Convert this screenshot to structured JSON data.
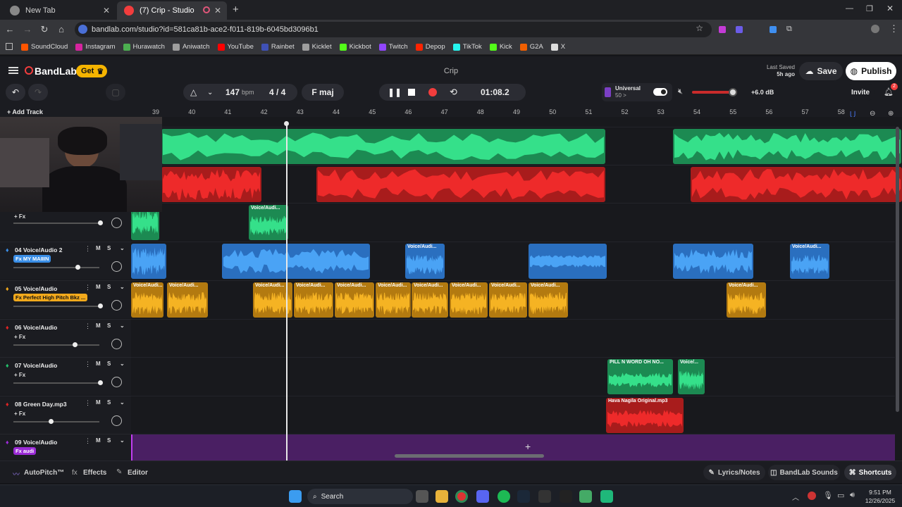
{
  "browser": {
    "tabs": [
      {
        "title": "New Tab"
      },
      {
        "title": "(7) Crip - Studio"
      }
    ],
    "new_tab_label": "+",
    "url": "bandlab.com/studio?id=581ca81b-ace2-f011-819b-6045bd3096b1",
    "bookmarks": [
      {
        "label": "SoundCloud",
        "color": "#ff5500"
      },
      {
        "label": "Instagram",
        "color": "#d6249f"
      },
      {
        "label": "Hurawatch",
        "color": "#4caf50"
      },
      {
        "label": "Aniwatch",
        "color": "#9e9e9e"
      },
      {
        "label": "YouTube",
        "color": "#ff0000"
      },
      {
        "label": "Rainbet",
        "color": "#3f51b5"
      },
      {
        "label": "Kicklet",
        "color": "#9e9e9e"
      },
      {
        "label": "Kickbot",
        "color": "#53fc18"
      },
      {
        "label": "Twitch",
        "color": "#9146ff"
      },
      {
        "label": "Depop",
        "color": "#ff2300"
      },
      {
        "label": "TikTok",
        "color": "#25f4ee"
      },
      {
        "label": "Kick",
        "color": "#53fc18"
      },
      {
        "label": "G2A",
        "color": "#f05f00"
      },
      {
        "label": "X",
        "color": "#dddddd"
      }
    ]
  },
  "studio": {
    "brand": "BandLab",
    "get_label": "Get",
    "project_title": "Crip",
    "last_saved_label": "Last Saved",
    "last_saved_value": "5h ago",
    "save_label": "Save",
    "publish_label": "Publish",
    "tempo": "147",
    "tempo_unit": "bpm",
    "time_sig": "4 / 4",
    "key": "F maj",
    "time": "01:08.2",
    "preset_name": "Universal",
    "preset_sub": "50 >",
    "master_db": "+6.0 dB",
    "invite_label": "Invite",
    "notif_count": "2",
    "add_track_label": "+ Add Track",
    "accent": "#f23d3d"
  },
  "ruler": {
    "bars": [
      "39",
      "40",
      "41",
      "42",
      "43",
      "44",
      "45",
      "46",
      "47",
      "48",
      "49",
      "50",
      "51",
      "52",
      "53",
      "54",
      "55",
      "56",
      "57",
      "58"
    ]
  },
  "tracks": [
    {
      "num": "",
      "name": "",
      "fx": "+ Fx",
      "color": "#23c16b"
    },
    {
      "num": "",
      "name": "",
      "fx": "+ Fx",
      "color": "#e02424"
    },
    {
      "num": "",
      "name": "",
      "fx": "+ Fx",
      "color": "#23c16b"
    },
    {
      "num": "04",
      "name": "Voice/Audio 2",
      "fx": "Fx MY MAIIIN",
      "color": "#3a8ee6"
    },
    {
      "num": "05",
      "name": "Voice/Audio",
      "fx": "Fx Perfect High Pitch Bkz ...",
      "color": "#f2a91c"
    },
    {
      "num": "06",
      "name": "Voice/Audio",
      "fx": "+ Fx",
      "color": "#e02424"
    },
    {
      "num": "07",
      "name": "Voice/Audio",
      "fx": "+ Fx",
      "color": "#23c16b"
    },
    {
      "num": "08",
      "name": "Green Day.mp3",
      "fx": "+ Fx",
      "color": "#e02424"
    },
    {
      "num": "09",
      "name": "Voice/Audio",
      "fx": "Fx audi",
      "color": "#9b2bd6"
    }
  ],
  "clip_labels": {
    "voice": "Voice/Audi...",
    "voice_short": "Voice/...",
    "pill": "PILL N WORD OH NO...",
    "hava": "Hava Nagila Original.mp3"
  },
  "mute_label": "M",
  "solo_label": "S",
  "bottom": {
    "autopitch": "AutoPitch™",
    "effects": "Effects",
    "editor": "Editor",
    "lyrics": "Lyrics/Notes",
    "sounds": "BandLab Sounds",
    "shortcuts": "Shortcuts"
  },
  "taskbar": {
    "search": "Search",
    "time": "9:51 PM",
    "date": "12/26/2025"
  }
}
